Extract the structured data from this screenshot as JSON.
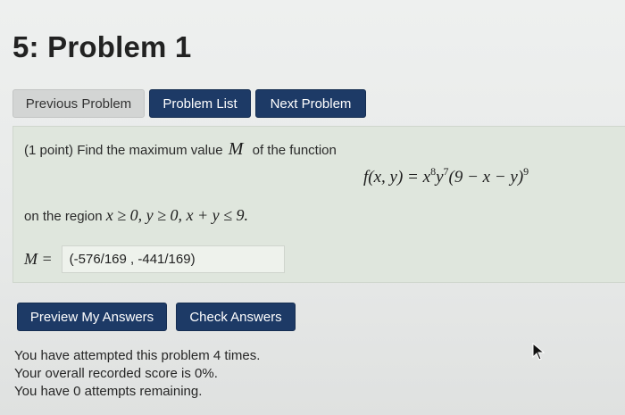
{
  "page": {
    "title": "5: Problem 1"
  },
  "nav": {
    "previous": "Previous Problem",
    "list": "Problem List",
    "next": "Next Problem"
  },
  "problem": {
    "prompt_prefix": "(1 point) Find the maximum value",
    "prompt_var": "M",
    "prompt_suffix": "of the function",
    "formula": {
      "lhs": "f(x, y) = x",
      "exp1": "8",
      "mid1": "y",
      "exp2": "7",
      "mid2": "(9 − x − y)",
      "exp3": "9"
    },
    "region_prefix": "on the region",
    "region_math": "x ≥ 0, y ≥ 0, x + y ≤ 9."
  },
  "answer": {
    "label": "M =",
    "value": "(-576/169 , -441/169)"
  },
  "actions": {
    "preview": "Preview My Answers",
    "check": "Check Answers"
  },
  "status": {
    "attempts": "You have attempted this problem 4 times.",
    "score": "Your overall recorded score is 0%.",
    "remaining": "You have 0 attempts remaining."
  }
}
